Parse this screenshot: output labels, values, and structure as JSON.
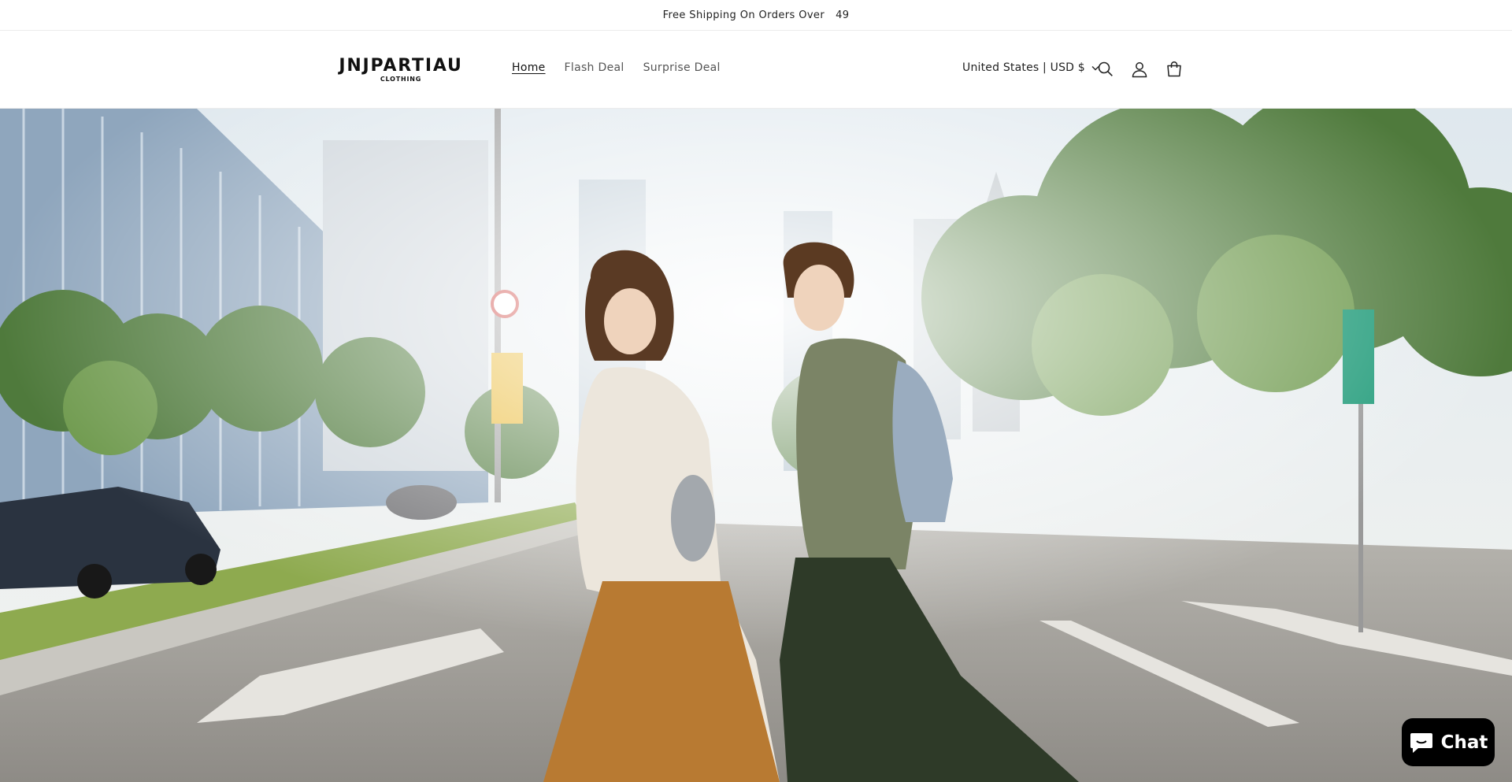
{
  "announcement": {
    "text": "Free Shipping On Orders Over",
    "amount": "49"
  },
  "header": {
    "logo_text": "JNJPARTIAU",
    "logo_sub": "CLOTHING",
    "nav": [
      {
        "label": "Home",
        "active": true
      },
      {
        "label": "Flash Deal",
        "active": false
      },
      {
        "label": "Surprise Deal",
        "active": false
      }
    ],
    "locale": "United States | USD $",
    "icons": [
      "search-icon",
      "account-icon",
      "cart-icon"
    ]
  },
  "chat": {
    "label": "Chat"
  },
  "colors": {
    "text": "#121212",
    "muted": "#555555",
    "chat_bg": "#000000"
  }
}
